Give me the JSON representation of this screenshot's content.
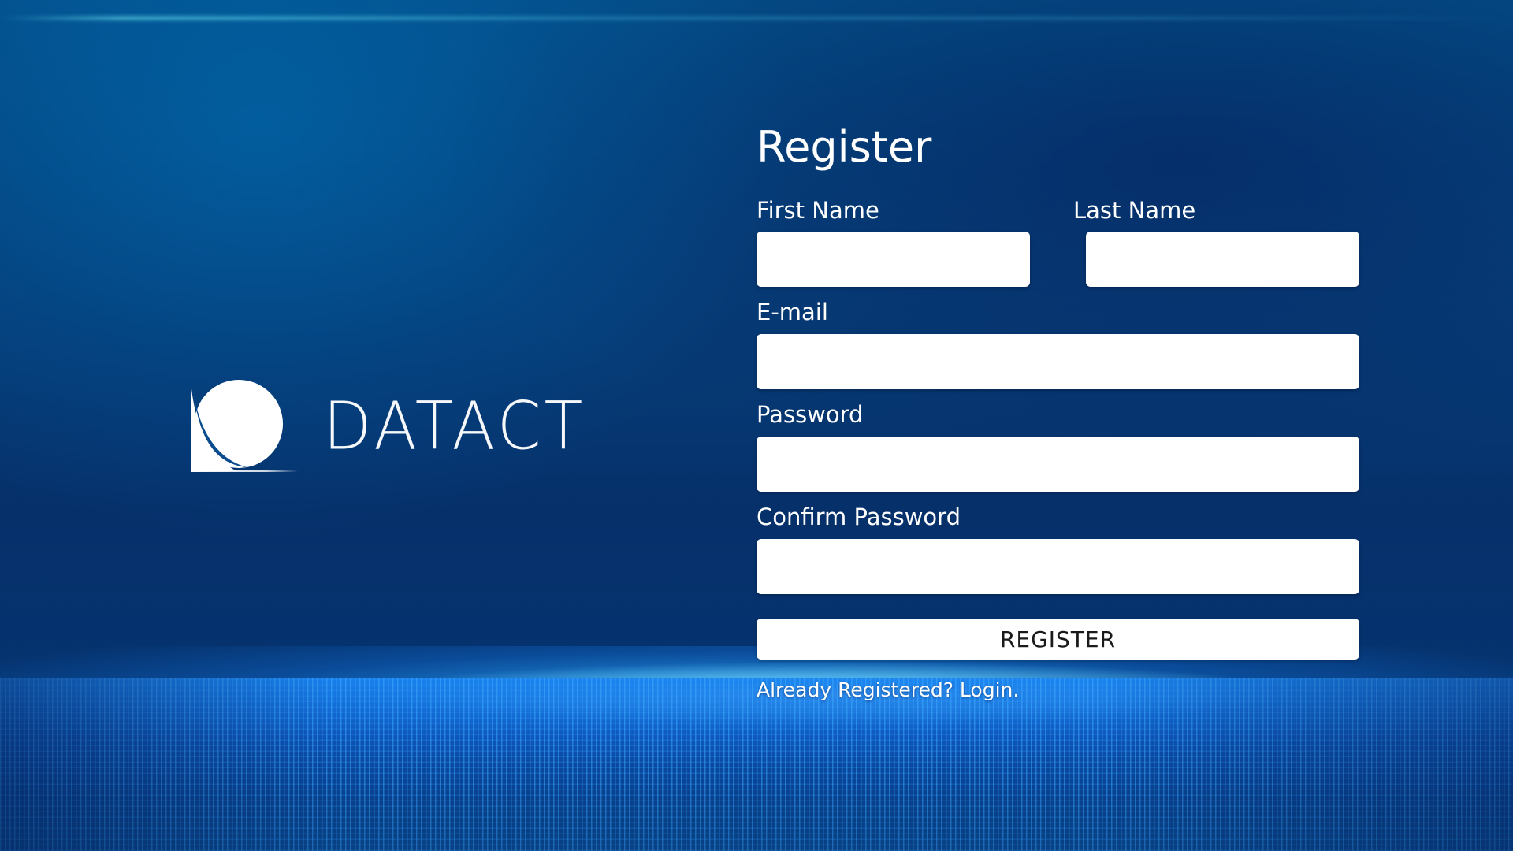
{
  "app": {
    "logo_text": "DATACT"
  },
  "form": {
    "title": "Register",
    "first_name": {
      "label": "First Name",
      "value": "",
      "placeholder": ""
    },
    "last_name": {
      "label": "Last Name",
      "value": "",
      "placeholder": ""
    },
    "email": {
      "label": "E-mail",
      "value": "",
      "placeholder": ""
    },
    "password": {
      "label": "Password",
      "value": "",
      "placeholder": ""
    },
    "confirm_password": {
      "label": "Confirm Password",
      "value": "",
      "placeholder": ""
    },
    "submit_label": "REGISTER",
    "login_link": "Already Registered? Login."
  },
  "colors": {
    "background_top": "#04508a",
    "background_mid": "#06306a",
    "glow": "#28aaff",
    "field_background": "#ffffff",
    "text": "#ffffff"
  }
}
